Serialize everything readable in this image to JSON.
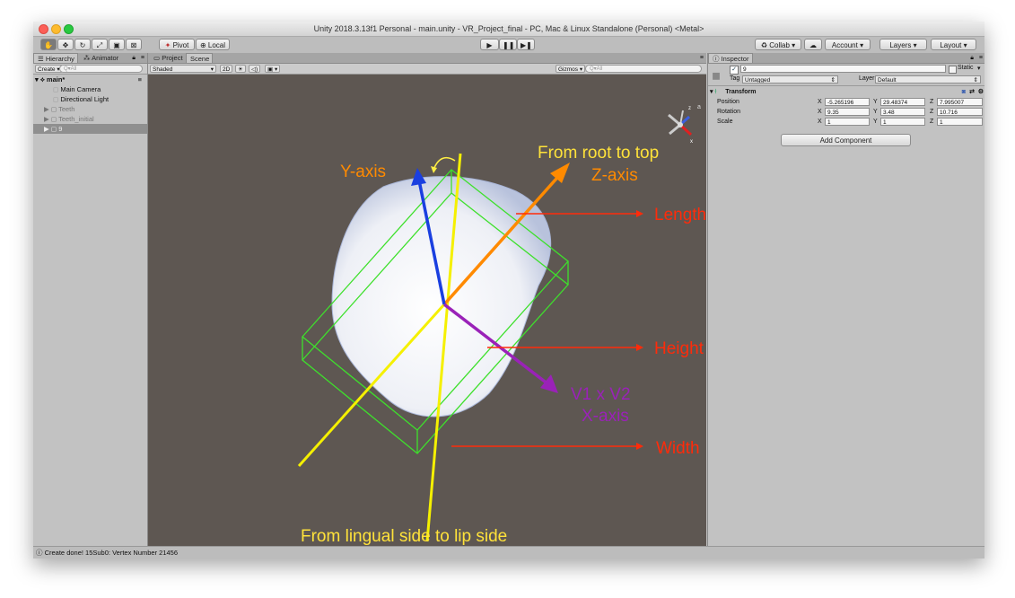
{
  "window": {
    "title": "Unity 2018.3.13f1 Personal - main.unity - VR_Project_final - PC, Mac & Linux Standalone (Personal) <Metal>"
  },
  "toolbar": {
    "pivot": "Pivot",
    "local": "Local",
    "collab": "Collab",
    "account": "Account",
    "layers": "Layers",
    "layout": "Layout"
  },
  "hierarchy": {
    "tab": "Hierarchy",
    "animator_tab": "Animator",
    "create": "Create",
    "search_placeholder": "Q▾All",
    "scene_name": "main*",
    "items": [
      {
        "label": "Main Camera"
      },
      {
        "label": "Directional Light"
      },
      {
        "label": "Teeth"
      },
      {
        "label": "Teeth_initial"
      },
      {
        "label": "9"
      }
    ]
  },
  "scene_panel": {
    "project_tab": "Project",
    "scene_tab": "Scene",
    "shading_mode": "Shaded",
    "mode_2d": "2D",
    "gizmos": "Gizmos",
    "search_placeholder": "Q▾All"
  },
  "annotations": {
    "y_axis": "Y-axis",
    "root_to_top": "From root to top",
    "z_axis": "Z-axis",
    "length": "Length",
    "height": "Height",
    "v1xv2": "V1  x V2",
    "x_axis": "X-axis",
    "width": "Width",
    "lingual": "From lingual side to lip side"
  },
  "inspector": {
    "tab": "Inspector",
    "object_name": "9",
    "static_label": "Static",
    "tag_label": "Tag",
    "tag_value": "Untagged",
    "layer_label": "Layer",
    "layer_value": "Default",
    "component": "Transform",
    "position_label": "Position",
    "rotation_label": "Rotation",
    "scale_label": "Scale",
    "position": {
      "x": "-5.265196",
      "y": "29.48374",
      "z": "7.995007"
    },
    "rotation": {
      "x": "9.35",
      "y": "3.48",
      "z": "10.716"
    },
    "scale": {
      "x": "1",
      "y": "1",
      "z": "1"
    },
    "add_component": "Add Component"
  },
  "status": {
    "message": "Create done! 15Sub0: Vertex Number 21456"
  },
  "colors": {
    "scene_bg": "#5e5752",
    "y_axis": "#1a3fe0",
    "z_axis": "#ff8a00",
    "x_axis": "#9a22b8",
    "yellow_line": "#f5f000",
    "bbox": "#3ee02c",
    "annotation_red": "#ff2b0a"
  }
}
